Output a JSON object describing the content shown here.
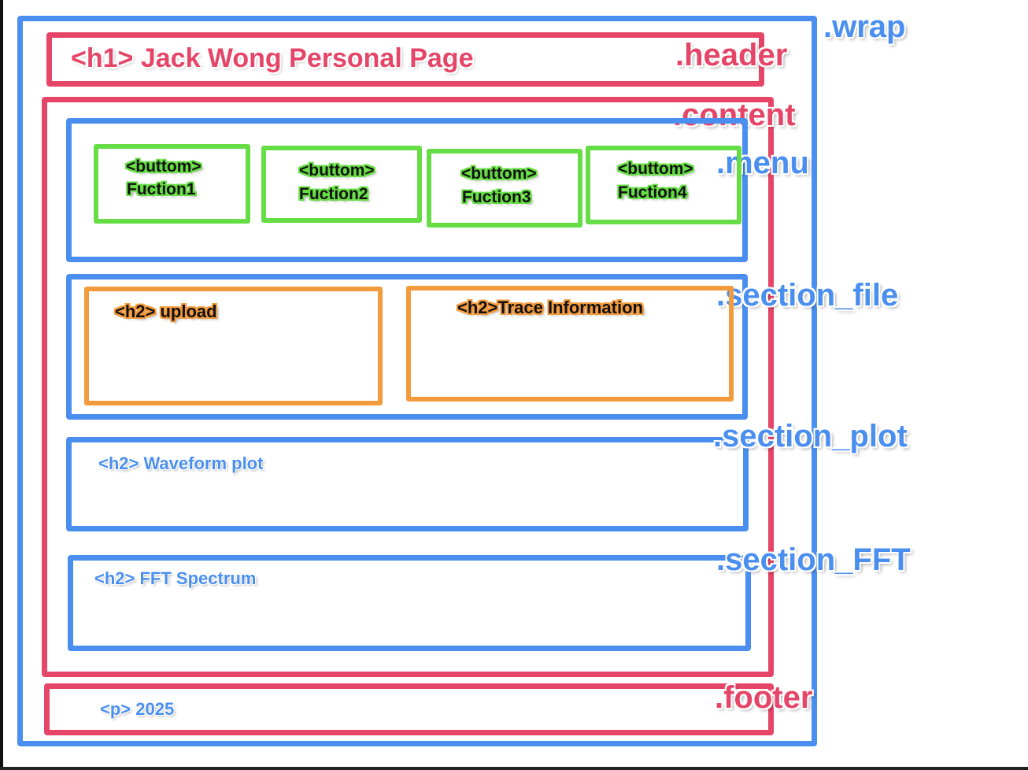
{
  "colors": {
    "blue": "#4a8ff0",
    "red": "#e54668",
    "green": "#66dd44",
    "orange": "#f39a3d"
  },
  "class_labels": {
    "wrap": ".wrap",
    "header": ".header",
    "content": ".content",
    "menu": ".menu",
    "section_file": ".section_file",
    "section_plot": ".section_plot",
    "section_fft": ".section_FFT",
    "footer": ".footer"
  },
  "header": {
    "h1": "<h1> Jack Wong Personal Page"
  },
  "menu": {
    "buttons": [
      {
        "tag": "<buttom>",
        "label": "Fuction1"
      },
      {
        "tag": "<buttom>",
        "label": "Fuction2"
      },
      {
        "tag": "<buttom>",
        "label": "Fuction3"
      },
      {
        "tag": "<buttom>",
        "label": "Fuction4"
      }
    ]
  },
  "section_file": {
    "upload": "<h2> upload",
    "trace": "<h2>Trace Information"
  },
  "section_plot": {
    "h2": "<h2> Waveform plot"
  },
  "section_fft": {
    "h2": "<h2> FFT Spectrum"
  },
  "footer": {
    "p": "<p> 2025"
  }
}
